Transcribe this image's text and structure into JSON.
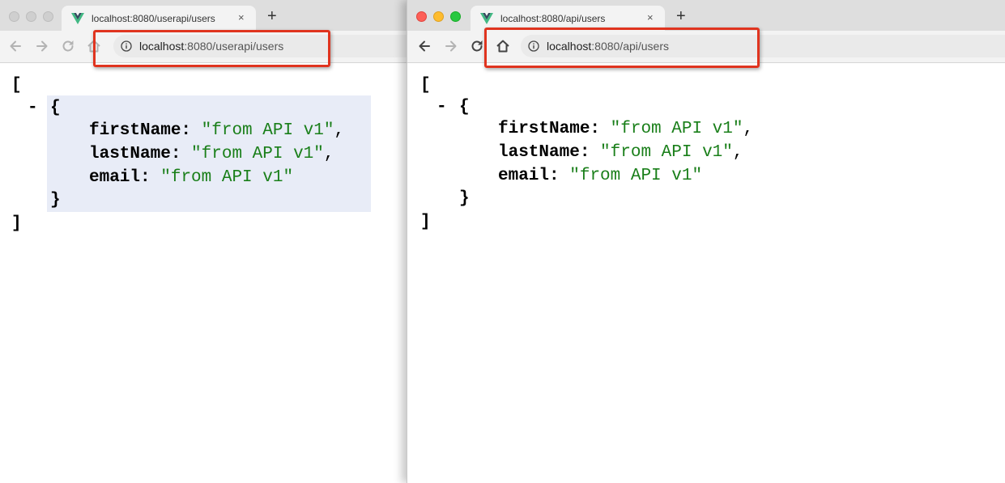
{
  "left": {
    "tab": {
      "title": "localhost:8080/userapi/users",
      "close": "×"
    },
    "newtab": "+",
    "url": {
      "host": "localhost",
      "rest": ":8080/userapi/users"
    }
  },
  "right": {
    "tab": {
      "title": "localhost:8080/api/users",
      "close": "×"
    },
    "newtab": "+",
    "url": {
      "host": "localhost",
      "rest": ":8080/api/users"
    }
  },
  "json": {
    "open_bracket": "[",
    "close_bracket": "]",
    "toggle": "-",
    "open_brace": "{",
    "close_brace": "}",
    "fields": [
      {
        "key": "firstName",
        "value": "\"from API v1\"",
        "suffix": ","
      },
      {
        "key": "lastName",
        "value": "\"from API v1\"",
        "suffix": ","
      },
      {
        "key": "email",
        "value": "\"from API v1\"",
        "suffix": ""
      }
    ]
  },
  "colors": {
    "highlight": "#e0341f",
    "string": "#1a7f1a",
    "selection": "#e8ecf7",
    "vue_green": "#41b883",
    "vue_dark": "#35495e"
  },
  "icons": [
    "vue-logo-icon",
    "back-arrow-icon",
    "forward-arrow-icon",
    "reload-icon",
    "home-icon",
    "info-icon",
    "close-icon",
    "new-tab-icon"
  ]
}
